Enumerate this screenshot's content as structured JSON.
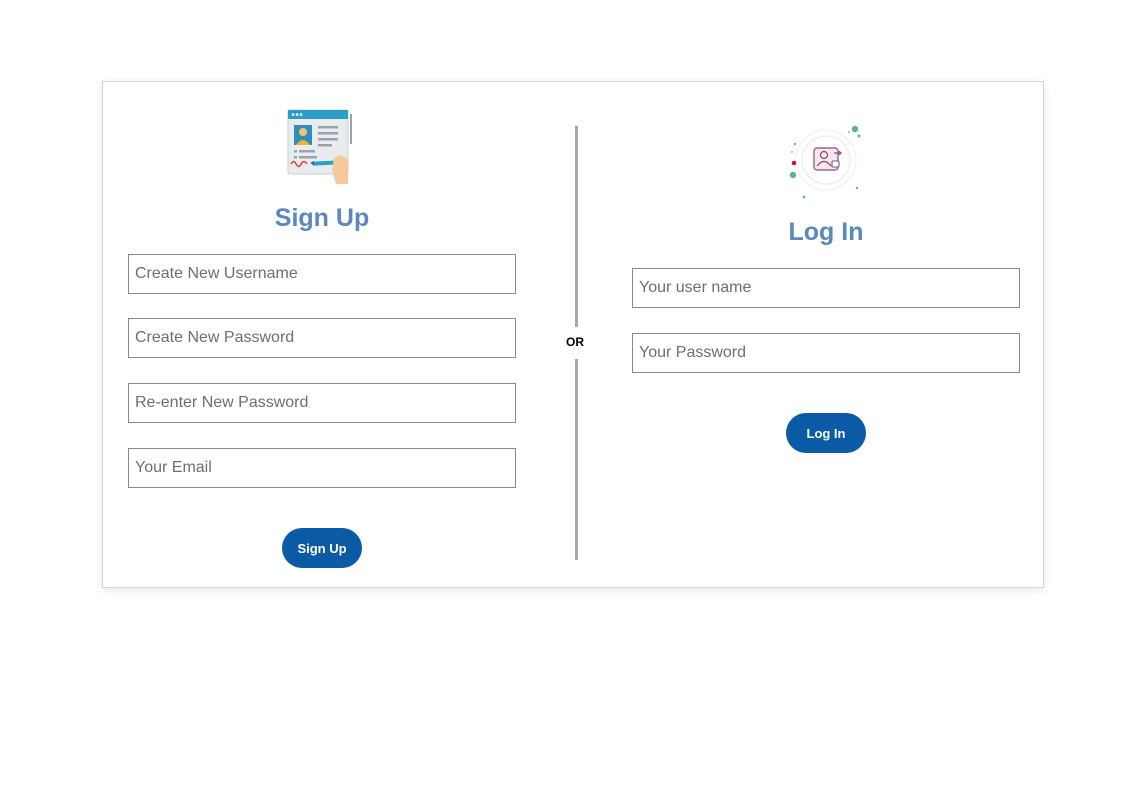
{
  "signup": {
    "title": "Sign Up",
    "username_placeholder": "Create New Username",
    "password_placeholder": "Create New Password",
    "reenter_placeholder": "Re-enter New Password",
    "email_placeholder": "Your Email",
    "button_label": "Sign Up"
  },
  "divider": {
    "label": "OR"
  },
  "login": {
    "title": "Log In",
    "username_placeholder": "Your user name",
    "password_placeholder": "Your Password",
    "button_label": "Log In"
  },
  "colors": {
    "title": "#5b88bd",
    "button": "#0a5aa5",
    "divider": "#a9a9a9",
    "field_border": "#8a8a8a"
  },
  "icons": {
    "signup": "registration-form-icon",
    "login": "user-login-icon"
  }
}
